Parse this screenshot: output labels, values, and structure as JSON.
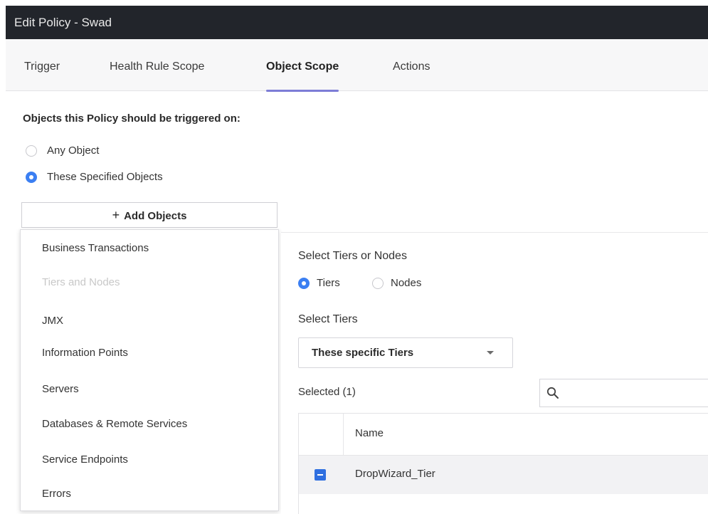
{
  "window": {
    "title": "Edit Policy - Swad"
  },
  "tabs": [
    {
      "label": "Trigger",
      "active": false
    },
    {
      "label": "Health Rule Scope",
      "active": false
    },
    {
      "label": "Object Scope",
      "active": true
    },
    {
      "label": "Actions",
      "active": false
    }
  ],
  "scope": {
    "heading": "Objects this Policy should be triggered on:",
    "options": [
      {
        "label": "Any Object",
        "selected": false
      },
      {
        "label": "These Specified Objects",
        "selected": true
      }
    ],
    "add_button": {
      "icon": "plus-icon",
      "label": "Add Objects"
    }
  },
  "object_menu": {
    "items": [
      {
        "label": "Business Transactions",
        "enabled": true
      },
      {
        "label": "Tiers and Nodes",
        "enabled": false
      },
      {
        "label": "JMX",
        "enabled": true
      },
      {
        "label": "Information Points",
        "enabled": true
      },
      {
        "label": "Servers",
        "enabled": true
      },
      {
        "label": "Databases & Remote Services",
        "enabled": true
      },
      {
        "label": "Service Endpoints",
        "enabled": true
      },
      {
        "label": "Errors",
        "enabled": true
      }
    ]
  },
  "tiers_panel": {
    "select_label": "Select Tiers or Nodes",
    "mode_options": [
      {
        "label": "Tiers",
        "selected": true
      },
      {
        "label": "Nodes",
        "selected": false
      }
    ],
    "select_tiers_label": "Select Tiers",
    "tiers_dropdown_value": "These specific Tiers",
    "selected_count_label": "Selected (1)",
    "search_icon": "search-icon",
    "table": {
      "column_name": "Name",
      "rows": [
        {
          "name": "DropWizard_Tier",
          "checked": true
        }
      ]
    }
  },
  "colors": {
    "titlebar": "#22252b",
    "accent": "#3b7ff2",
    "tab_underline": "#7d7dd6"
  }
}
